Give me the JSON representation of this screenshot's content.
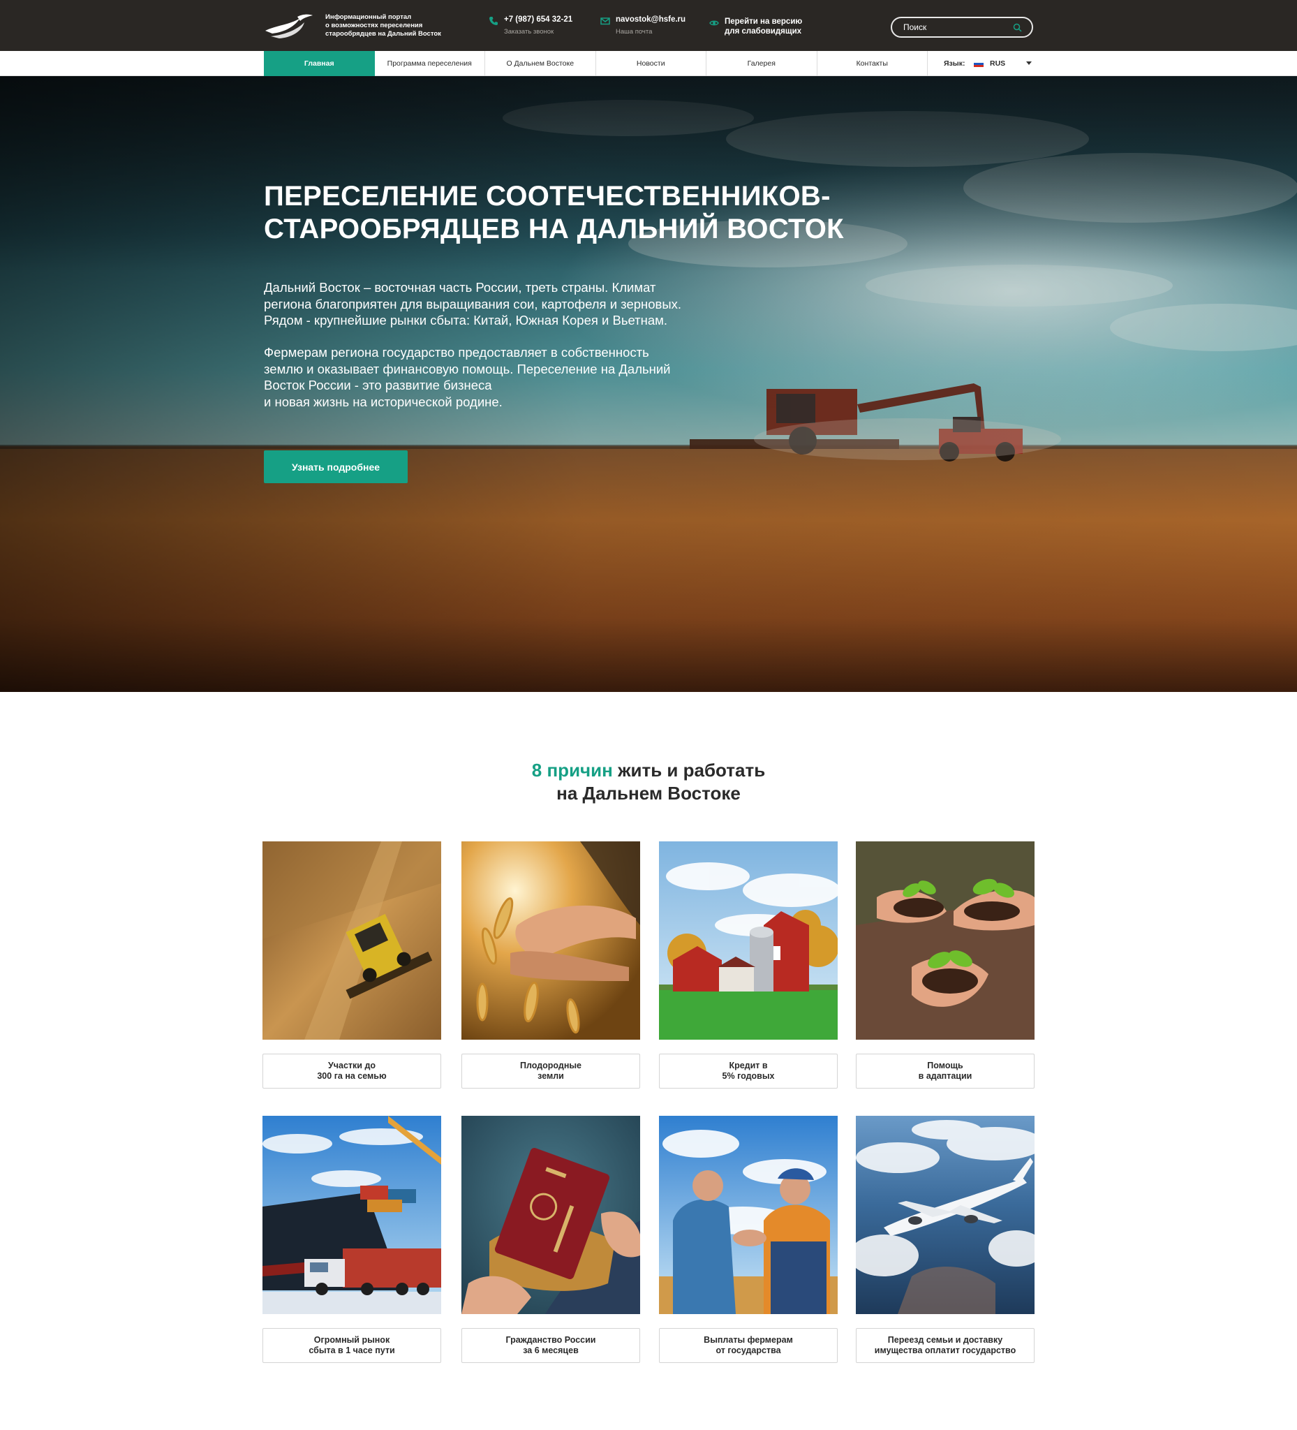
{
  "header": {
    "portal_title_lines": [
      "Информационный портал",
      "о возможностях переселения",
      "старообрядцев на Дальний Восток"
    ],
    "phone": "+7 (987) 654 32-21",
    "phone_sub": "Заказать звонок",
    "email": "navostok@hsfe.ru",
    "email_sub": "Наша почта",
    "accessible_version": "Перейти на версию для слабовидящих",
    "search_placeholder": "Поиск",
    "icons": {
      "phone": "phone-icon",
      "mail": "mail-icon",
      "eye": "eye-icon",
      "search": "search-icon",
      "logo": "bird-logo-icon"
    }
  },
  "nav": {
    "items": [
      {
        "label": "Главная",
        "active": true
      },
      {
        "label": "Программа переселения",
        "active": false
      },
      {
        "label": "О Дальнем Востоке",
        "active": false
      },
      {
        "label": "Новости",
        "active": false
      },
      {
        "label": "Галерея",
        "active": false
      },
      {
        "label": "Контакты",
        "active": false
      }
    ],
    "language_label": "Язык:",
    "language_value": "RUS"
  },
  "hero": {
    "title_lines": [
      "ПЕРЕСЕЛЕНИЕ СООТЕЧЕСТВЕННИКОВ-",
      "СТАРООБРЯДЦЕВ НА ДАЛЬНИЙ ВОСТОК"
    ],
    "paragraph1_lines": [
      "Дальний Восток – восточная часть России, треть страны.  Климат",
      "региона благоприятен для выращивания сои, картофеля и зерновых.",
      "Рядом - крупнейшие рынки сбыта: Китай, Южная Корея и Вьетнам."
    ],
    "paragraph2_lines": [
      "Фермерам региона государство предоставляет в собственность",
      "землю и оказывает финансовую помощь. Переселение на Дальний",
      "Восток России -  это развитие бизнеса",
      "и новая жизнь на исторической родине."
    ],
    "button": "Узнать подробнее"
  },
  "reasons": {
    "title_highlight": "8 причин",
    "title_rest": " жить и работать",
    "title_line2": "на Дальнем Востоке",
    "items": [
      {
        "caption": "Участки до\n300 га  на семью"
      },
      {
        "caption": "Плодородные\nземли"
      },
      {
        "caption": "Кредит в\n5% годовых"
      },
      {
        "caption": "Помощь\nв адаптации"
      },
      {
        "caption": "Огромный рынок\nсбыта в 1 часе пути"
      },
      {
        "caption": "Гражданство России\nза 6 месяцев"
      },
      {
        "caption": "Выплаты фермерам\nот  государства"
      },
      {
        "caption": "Переезд семьи и доставку\nимущества оплатит государство"
      }
    ]
  },
  "colors": {
    "accent": "#16a085",
    "topbar": "#2a2724"
  }
}
